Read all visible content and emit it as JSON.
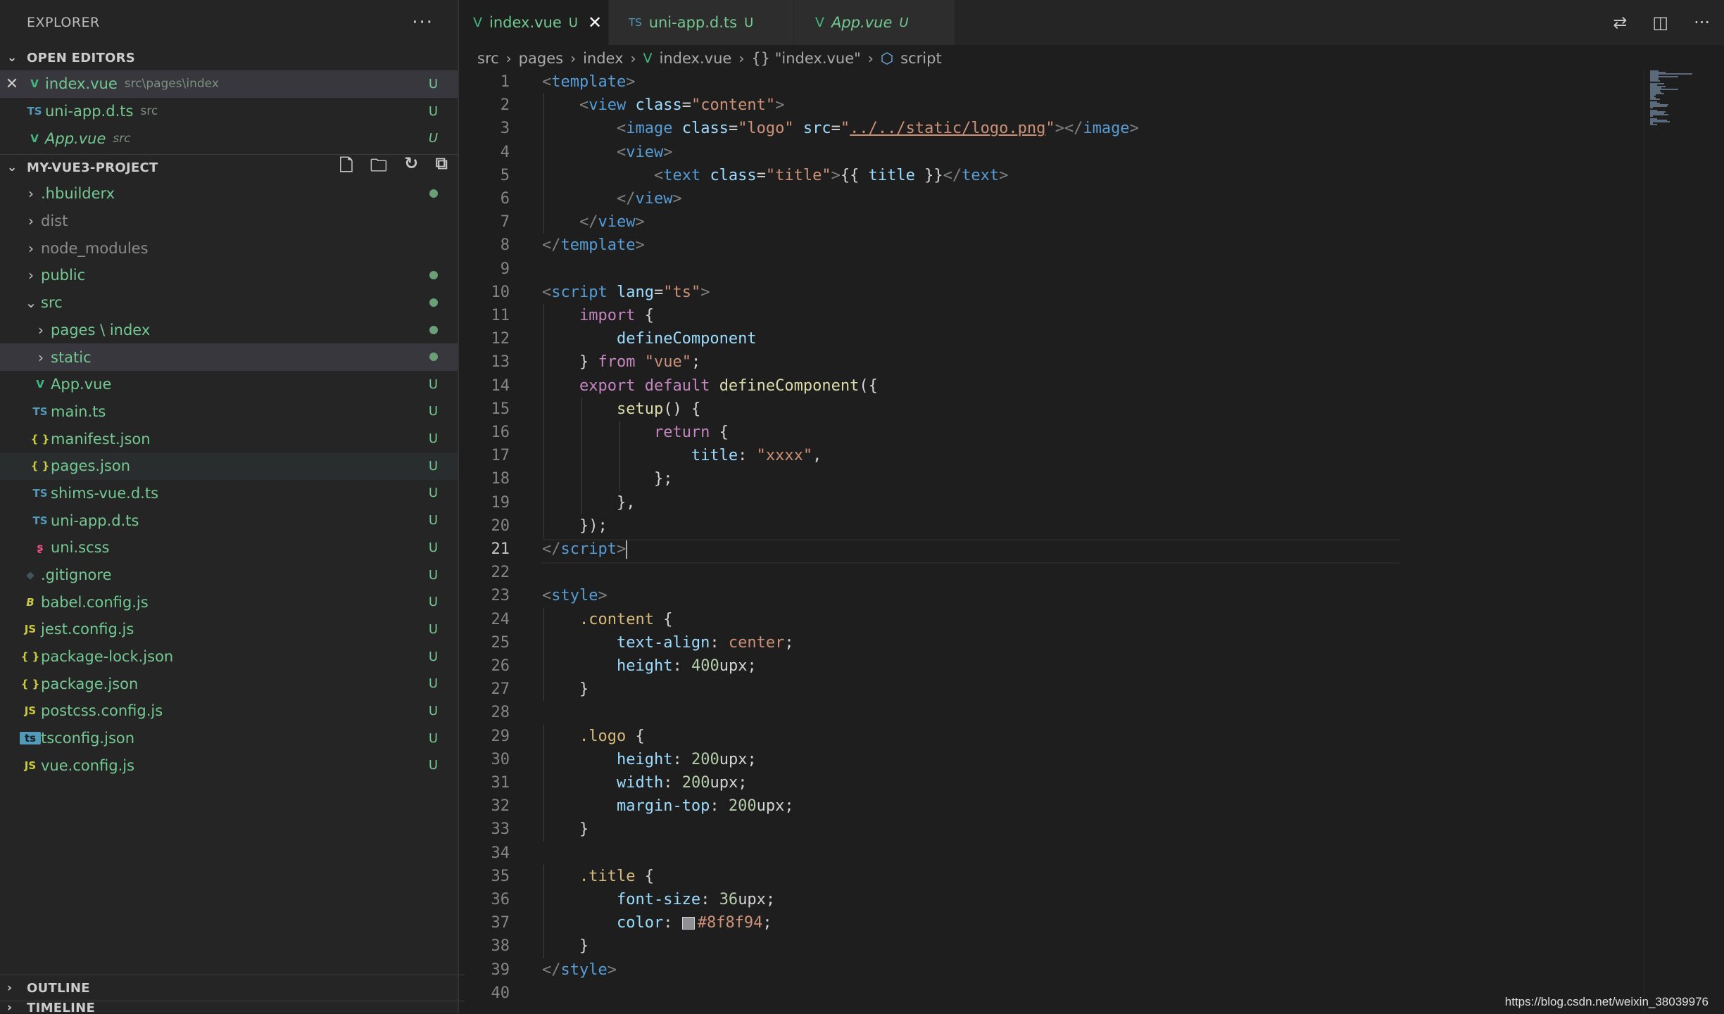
{
  "explorer": {
    "title": "EXPLORER",
    "more": "···",
    "open_editors_title": "OPEN EDITORS",
    "open_editors": [
      {
        "name": "index.vue",
        "desc": "src\\pages\\index",
        "badge": "U",
        "icon": "vue-icon"
      },
      {
        "name": "uni-app.d.ts",
        "desc": "src",
        "badge": "U",
        "icon": "ts-icon"
      },
      {
        "name": "App.vue",
        "desc": "src",
        "badge": "U",
        "icon": "vue-icon"
      }
    ],
    "project_title": "MY-VUE3-PROJECT",
    "tree": [
      {
        "name": ".hbuilderx",
        "kind": "folder"
      },
      {
        "name": "dist",
        "kind": "folder"
      },
      {
        "name": "node_modules",
        "kind": "folder"
      },
      {
        "name": "public",
        "kind": "folder"
      },
      {
        "name": "src",
        "kind": "folder-open"
      },
      {
        "name": "pages \\ index",
        "kind": "folder"
      },
      {
        "name": "static",
        "kind": "folder"
      },
      {
        "name": "App.vue",
        "badge": "U",
        "icon": "vue-icon",
        "icon_text": "V"
      },
      {
        "name": "main.ts",
        "badge": "U",
        "icon": "ts-icon",
        "icon_text": "TS"
      },
      {
        "name": "manifest.json",
        "badge": "U",
        "icon": "json-icon",
        "icon_text": "{ }"
      },
      {
        "name": "pages.json",
        "badge": "U",
        "icon": "json-icon",
        "icon_text": "{ }"
      },
      {
        "name": "shims-vue.d.ts",
        "badge": "U",
        "icon": "ts-icon",
        "icon_text": "TS"
      },
      {
        "name": "uni-app.d.ts",
        "badge": "U",
        "icon": "ts-icon",
        "icon_text": "TS"
      },
      {
        "name": "uni.scss",
        "badge": "U",
        "icon": "sass-icon",
        "icon_text": "ʂ"
      },
      {
        "name": ".gitignore",
        "badge": "U",
        "icon": "git-icon",
        "icon_text": "◆"
      },
      {
        "name": "babel.config.js",
        "badge": "U",
        "icon": "babel-icon",
        "icon_text": "B"
      },
      {
        "name": "jest.config.js",
        "badge": "U",
        "icon": "js-icon",
        "icon_text": "JS"
      },
      {
        "name": "package-lock.json",
        "badge": "U",
        "icon": "json-icon",
        "icon_text": "{ }"
      },
      {
        "name": "package.json",
        "badge": "U",
        "icon": "json-icon",
        "icon_text": "{ }"
      },
      {
        "name": "postcss.config.js",
        "badge": "U",
        "icon": "js-icon",
        "icon_text": "JS"
      },
      {
        "name": "tsconfig.json",
        "badge": "U",
        "icon": "tscfg-icon",
        "icon_text": "ts"
      },
      {
        "name": "vue.config.js",
        "badge": "U",
        "icon": "js-icon",
        "icon_text": "JS"
      }
    ],
    "outline_title": "OUTLINE",
    "timeline_title": "TIMELINE"
  },
  "tabs": [
    {
      "name": "index.vue",
      "badge": "U",
      "active": true
    },
    {
      "name": "uni-app.d.ts",
      "badge": "U",
      "active": false
    },
    {
      "name": "App.vue",
      "badge": "U",
      "active": false
    }
  ],
  "breadcrumb": [
    "src",
    "pages",
    "index",
    "index.vue",
    "{} \"index.vue\"",
    "script"
  ],
  "editor": {
    "active_line": 21,
    "line_numbers": [
      "1",
      "2",
      "3",
      "4",
      "5",
      "6",
      "7",
      "8",
      "9",
      "10",
      "11",
      "12",
      "13",
      "14",
      "15",
      "16",
      "17",
      "18",
      "19",
      "20",
      "21",
      "22",
      "23",
      "24",
      "25",
      "26",
      "27",
      "28",
      "29",
      "30",
      "31",
      "32",
      "33",
      "34",
      "35",
      "36",
      "37",
      "38",
      "39",
      "40"
    ]
  },
  "watermark": "https://blog.csdn.net/weixin_38039976",
  "colors": {
    "git_untracked": "#73c991",
    "editor_bg": "#1e1e1e",
    "sidebar_bg": "#252526"
  }
}
